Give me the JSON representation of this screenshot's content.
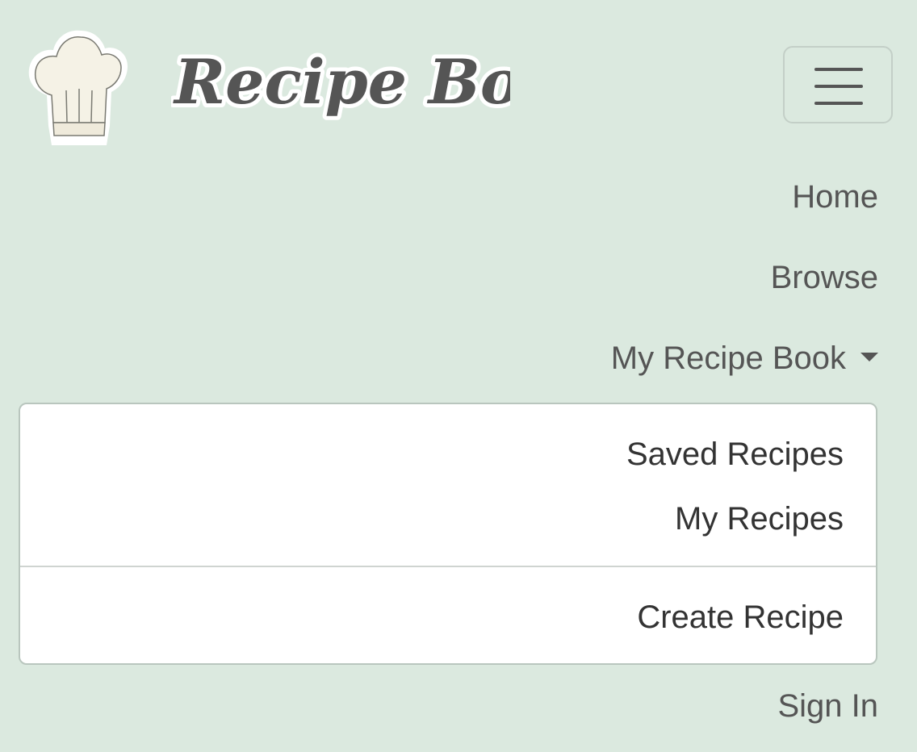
{
  "brand": {
    "name": "Recipe Book",
    "logo_icon": "chef-hat-icon"
  },
  "toggler": {
    "icon": "hamburger-menu-icon"
  },
  "nav": {
    "home": "Home",
    "browse": "Browse",
    "my_recipe_book": "My Recipe Book",
    "sign_in": "Sign In"
  },
  "dropdown": {
    "saved_recipes": "Saved Recipes",
    "my_recipes": "My Recipes",
    "create_recipe": "Create Recipe"
  },
  "colors": {
    "background": "#dbe9df",
    "text": "#555555",
    "menu_background": "#ffffff"
  }
}
